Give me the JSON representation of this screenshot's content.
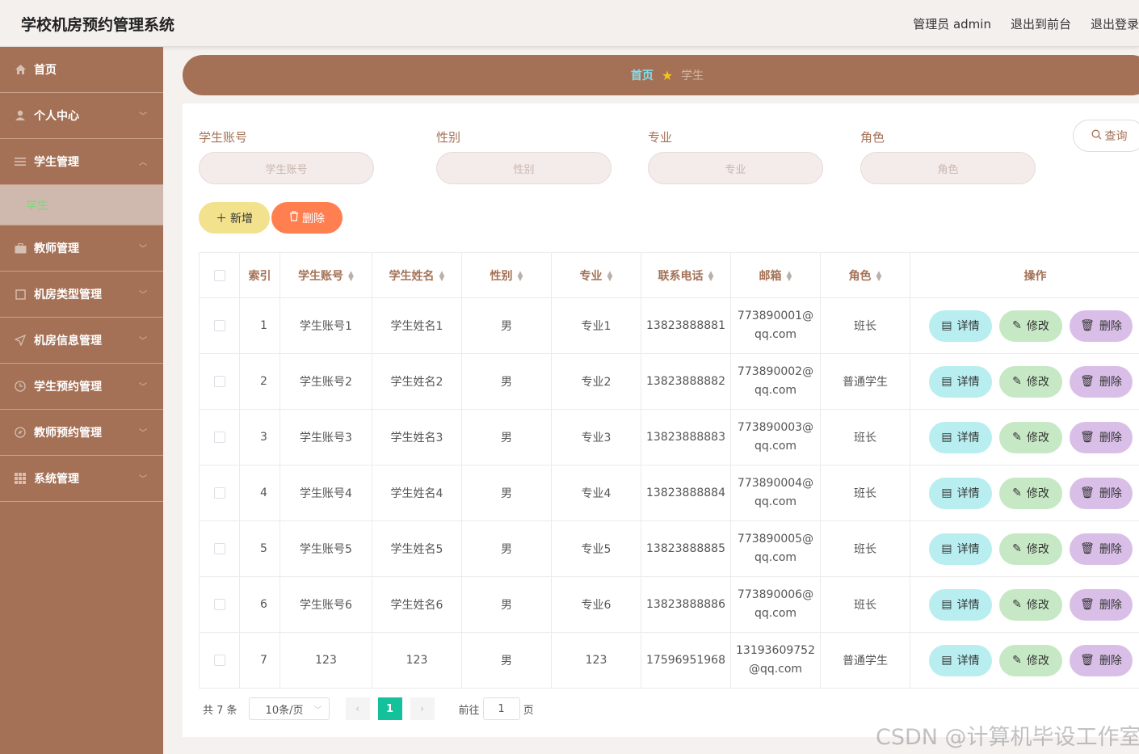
{
  "header": {
    "app_title": "学校机房预约管理系统",
    "admin_label": "管理员 admin",
    "front_link": "退出到前台",
    "logout_link": "退出登录"
  },
  "sidebar": {
    "items": [
      {
        "label": "首页",
        "icon": "home-icon"
      },
      {
        "label": "个人中心",
        "icon": "user-icon"
      },
      {
        "label": "学生管理",
        "icon": "list-icon",
        "expanded": true,
        "sub": [
          {
            "label": "学生",
            "active": true
          }
        ]
      },
      {
        "label": "教师管理",
        "icon": "briefcase-icon"
      },
      {
        "label": "机房类型管理",
        "icon": "square-icon"
      },
      {
        "label": "机房信息管理",
        "icon": "send-icon"
      },
      {
        "label": "学生预约管理",
        "icon": "clock-icon"
      },
      {
        "label": "教师预约管理",
        "icon": "compass-icon"
      },
      {
        "label": "系统管理",
        "icon": "grid-icon"
      }
    ]
  },
  "breadcrumb": {
    "home": "首页",
    "current": "学生"
  },
  "search": {
    "fields": [
      {
        "label": "学生账号",
        "placeholder": "学生账号"
      },
      {
        "label": "性别",
        "placeholder": "性别"
      },
      {
        "label": "专业",
        "placeholder": "专业"
      },
      {
        "label": "角色",
        "placeholder": "角色"
      }
    ],
    "query_button": "查询"
  },
  "actions": {
    "add_label": "新增",
    "delete_label": "删除"
  },
  "table": {
    "headers": [
      "索引",
      "学生账号",
      "学生姓名",
      "性别",
      "专业",
      "联系电话",
      "邮箱",
      "角色",
      "操作"
    ],
    "op_labels": {
      "detail": "详情",
      "edit": "修改",
      "delete": "删除"
    },
    "rows": [
      {
        "index": "1",
        "account": "学生账号1",
        "name": "学生姓名1",
        "gender": "男",
        "major": "专业1",
        "phone": "13823888881",
        "email_1": "773890001@",
        "email_2": "qq.com",
        "role": "班长"
      },
      {
        "index": "2",
        "account": "学生账号2",
        "name": "学生姓名2",
        "gender": "男",
        "major": "专业2",
        "phone": "13823888882",
        "email_1": "773890002@",
        "email_2": "qq.com",
        "role": "普通学生"
      },
      {
        "index": "3",
        "account": "学生账号3",
        "name": "学生姓名3",
        "gender": "男",
        "major": "专业3",
        "phone": "13823888883",
        "email_1": "773890003@",
        "email_2": "qq.com",
        "role": "班长"
      },
      {
        "index": "4",
        "account": "学生账号4",
        "name": "学生姓名4",
        "gender": "男",
        "major": "专业4",
        "phone": "13823888884",
        "email_1": "773890004@",
        "email_2": "qq.com",
        "role": "班长"
      },
      {
        "index": "5",
        "account": "学生账号5",
        "name": "学生姓名5",
        "gender": "男",
        "major": "专业5",
        "phone": "13823888885",
        "email_1": "773890005@",
        "email_2": "qq.com",
        "role": "班长"
      },
      {
        "index": "6",
        "account": "学生账号6",
        "name": "学生姓名6",
        "gender": "男",
        "major": "专业6",
        "phone": "13823888886",
        "email_1": "773890006@",
        "email_2": "qq.com",
        "role": "班长"
      },
      {
        "index": "7",
        "account": "123",
        "name": "123",
        "gender": "男",
        "major": "123",
        "phone": "17596951968",
        "email_1": "13193609752",
        "email_2": "@qq.com",
        "role": "普通学生"
      }
    ]
  },
  "pagination": {
    "total": "共 7 条",
    "page_size": "10条/页",
    "current_page": "1",
    "goto_label": "前往",
    "goto_value": "1",
    "page_suffix": "页"
  },
  "watermark": "CSDN @计算机毕设工作室"
}
